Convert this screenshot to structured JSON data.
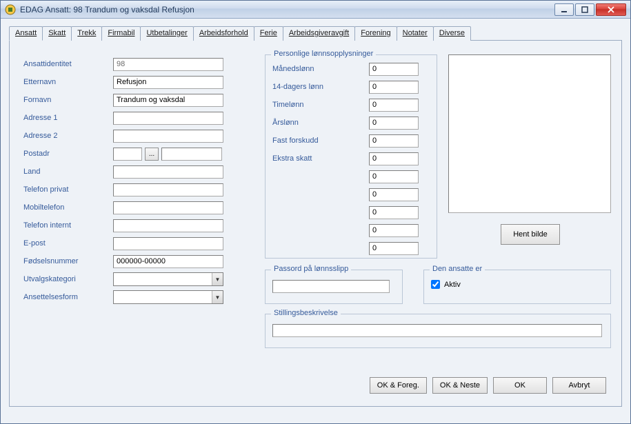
{
  "window": {
    "title": "EDAG Ansatt: 98 Trandum og vaksdal Refusjon"
  },
  "tabs": [
    {
      "label": "Ansatt",
      "active": true
    },
    {
      "label": "Skatt"
    },
    {
      "label": "Trekk"
    },
    {
      "label": "Firmabil"
    },
    {
      "label": "Utbetalinger"
    },
    {
      "label": "Arbeidsforhold"
    },
    {
      "label": "Ferie"
    },
    {
      "label": "Arbeidsgiveravgift"
    },
    {
      "label": "Forening"
    },
    {
      "label": "Notater"
    },
    {
      "label": "Diverse"
    }
  ],
  "left": {
    "ansattidentitet": {
      "label": "Ansattidentitet",
      "value": "98"
    },
    "etternavn": {
      "label": "Etternavn",
      "value": "Refusjon"
    },
    "fornavn": {
      "label": "Fornavn",
      "value": "Trandum og vaksdal"
    },
    "adresse1": {
      "label": "Adresse 1",
      "value": ""
    },
    "adresse2": {
      "label": "Adresse 2",
      "value": ""
    },
    "postadr": {
      "label": "Postadr",
      "value1": "",
      "value2": "",
      "lookup": "..."
    },
    "land": {
      "label": "Land",
      "value": ""
    },
    "telefon_privat": {
      "label": "Telefon privat",
      "value": ""
    },
    "mobiltelefon": {
      "label": "Mobiltelefon",
      "value": ""
    },
    "telefon_internt": {
      "label": "Telefon internt",
      "value": ""
    },
    "epost": {
      "label": "E-post",
      "value": ""
    },
    "fodselsnummer": {
      "label": "Fødselsnummer",
      "value": "000000-00000"
    },
    "utvalgskategori": {
      "label": "Utvalgskategori",
      "value": ""
    },
    "ansettelsesform": {
      "label": "Ansettelsesform",
      "value": ""
    }
  },
  "pay": {
    "legend": "Personlige lønnsopplysninger",
    "rows": [
      {
        "label": "Månedslønn",
        "value": "0"
      },
      {
        "label": "14-dagers lønn",
        "value": "0"
      },
      {
        "label": "Timelønn",
        "value": "0"
      },
      {
        "label": "Årslønn",
        "value": "0"
      },
      {
        "label": "Fast forskudd",
        "value": "0"
      },
      {
        "label": "Ekstra skatt",
        "value": "0"
      },
      {
        "label": "",
        "value": "0"
      },
      {
        "label": "",
        "value": "0"
      },
      {
        "label": "",
        "value": "0"
      },
      {
        "label": "",
        "value": "0"
      },
      {
        "label": "",
        "value": "0"
      }
    ]
  },
  "password": {
    "legend": "Passord på lønnsslipp",
    "value": ""
  },
  "active": {
    "legend": "Den ansatte er",
    "checkbox_label": "Aktiv",
    "checked": true
  },
  "desc": {
    "legend": "Stillingsbeskrivelse",
    "value": ""
  },
  "image_button": "Hent bilde",
  "footer": {
    "ok_prev": "OK & Foreg.",
    "ok_next": "OK & Neste",
    "ok": "OK",
    "cancel": "Avbryt"
  }
}
